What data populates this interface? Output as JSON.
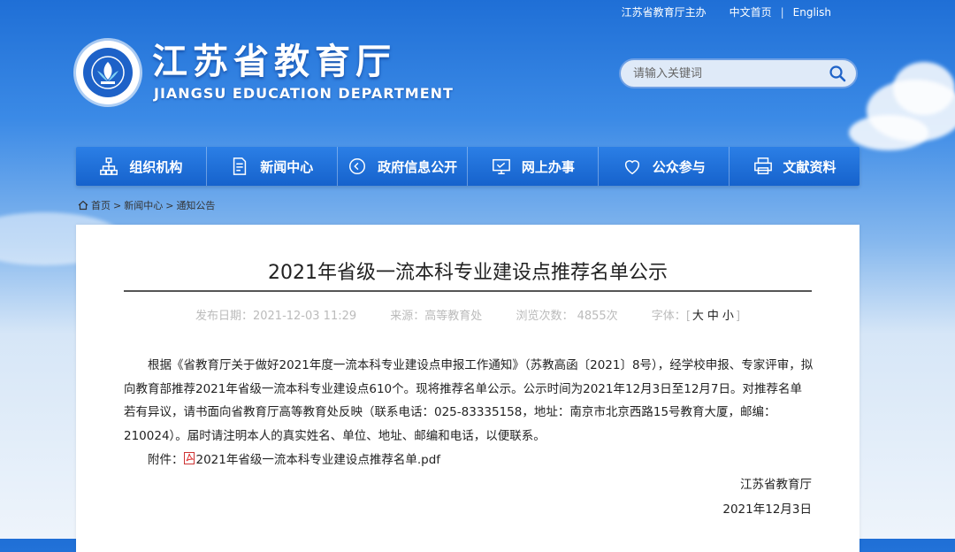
{
  "topbar": {
    "sponsor": "江苏省教育厅主办",
    "home": "中文首页",
    "separator": "|",
    "english": "English"
  },
  "header": {
    "title": "江苏省教育厅",
    "subtitle": "JIANGSU EDUCATION DEPARTMENT",
    "logo_icon": "education-emblem-icon",
    "brand_color": "#1e62c8"
  },
  "search": {
    "placeholder": "请输入关键词",
    "icon": "search-icon"
  },
  "nav": {
    "items": [
      {
        "label": "组织机构",
        "icon": "org-chart-icon"
      },
      {
        "label": "新闻中心",
        "icon": "document-icon"
      },
      {
        "label": "政府信息公开",
        "icon": "arrow-circle-icon"
      },
      {
        "label": "网上办事",
        "icon": "monitor-icon"
      },
      {
        "label": "公众参与",
        "icon": "heart-icon"
      },
      {
        "label": "文献资料",
        "icon": "printer-icon"
      }
    ]
  },
  "breadcrumb": {
    "home": "首页",
    "sep": ">",
    "news": "新闻中心",
    "notice": "通知公告"
  },
  "article": {
    "title": "2021年省级一流本科专业建设点推荐名单公示",
    "meta": {
      "date": "发布日期：2021-12-03 11:29",
      "source": "来源：高等教育处",
      "views": "浏览次数：  4855次",
      "font_label": "字体：",
      "font_open": "[",
      "font_large": "大",
      "font_medium": "中",
      "font_small": "小",
      "font_close": "]"
    },
    "body": "根据《省教育厅关于做好2021年度一流本科专业建设点申报工作通知》（苏教高函〔2021〕8号），经学校申报、专家评审，拟向教育部推荐2021年省级一流本科专业建设点610个。现将推荐名单公示。公示时间为2021年12月3日至12月7日。对推荐名单若有异议，请书面向省教育厅高等教育处反映（联系电话：025-83335158，地址：南京市北京西路15号教育大厦，邮编：210024）。届时请注明本人的真实姓名、单位、地址、邮编和电话，以便联系。",
    "attachment_label": "附件：",
    "attachment_name": "2021年省级一流本科专业建设点推荐名单.pdf",
    "signature": "江苏省教育厅",
    "sign_date": "2021年12月3日"
  }
}
